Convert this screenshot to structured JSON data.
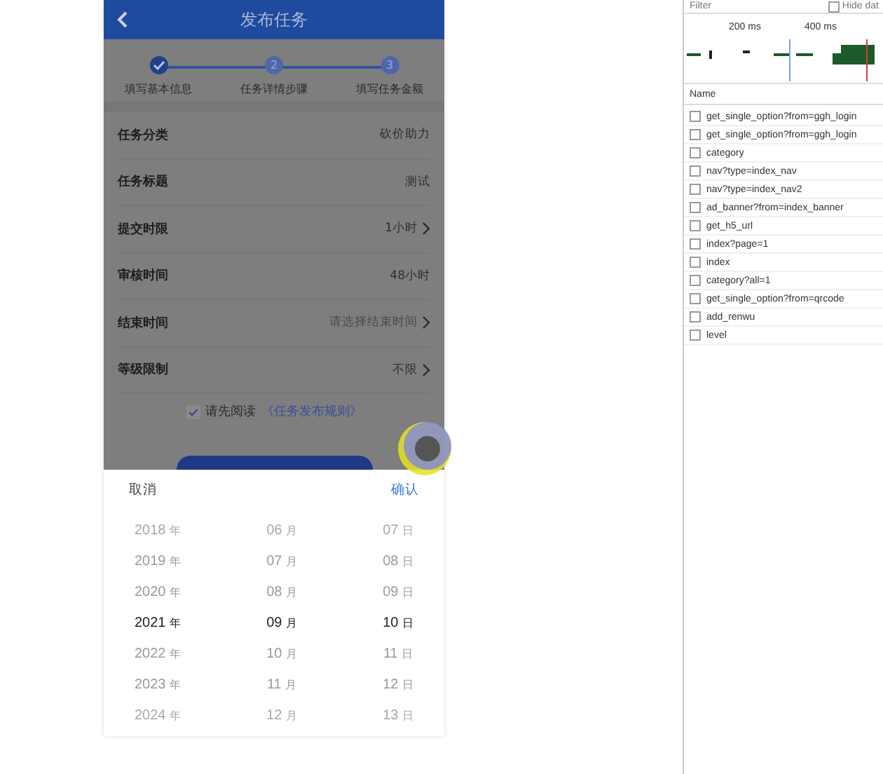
{
  "phone": {
    "title": "发布任务",
    "steps": [
      {
        "label": "填写基本信息",
        "done": true
      },
      {
        "label": "任务详情步骤",
        "number": "2",
        "done": false
      },
      {
        "label": "填写任务金额",
        "number": "3",
        "done": false
      }
    ],
    "fields": [
      {
        "label": "任务分类",
        "value": "砍价助力",
        "arrow": false
      },
      {
        "label": "任务标题",
        "value": "测试",
        "arrow": false
      },
      {
        "label": "提交时限",
        "value": "1小时",
        "arrow": true
      },
      {
        "label": "审核时间",
        "value": "48小时",
        "arrow": false
      },
      {
        "label": "结束时间",
        "placeholder": "请选择结束时间",
        "arrow": true
      },
      {
        "label": "等级限制",
        "value": "不限",
        "arrow": true
      }
    ],
    "agreement": {
      "checked": true,
      "text": "请先阅读",
      "link": "《任务发布规则》"
    },
    "picker": {
      "cancel": "取消",
      "confirm": "确认",
      "columns": [
        {
          "items": [
            {
              "value": "2018",
              "unit": "年",
              "selected": false
            },
            {
              "value": "2019",
              "unit": "年",
              "selected": false
            },
            {
              "value": "2020",
              "unit": "年",
              "selected": false
            },
            {
              "value": "2021",
              "unit": "年",
              "selected": true
            },
            {
              "value": "2022",
              "unit": "年",
              "selected": false
            },
            {
              "value": "2023",
              "unit": "年",
              "selected": false
            },
            {
              "value": "2024",
              "unit": "年",
              "selected": false
            }
          ]
        },
        {
          "items": [
            {
              "value": "06",
              "unit": "月",
              "selected": false
            },
            {
              "value": "07",
              "unit": "月",
              "selected": false
            },
            {
              "value": "08",
              "unit": "月",
              "selected": false
            },
            {
              "value": "09",
              "unit": "月",
              "selected": true
            },
            {
              "value": "10",
              "unit": "月",
              "selected": false
            },
            {
              "value": "11",
              "unit": "月",
              "selected": false
            },
            {
              "value": "12",
              "unit": "月",
              "selected": false
            }
          ]
        },
        {
          "items": [
            {
              "value": "07",
              "unit": "日",
              "selected": false
            },
            {
              "value": "08",
              "unit": "日",
              "selected": false
            },
            {
              "value": "09",
              "unit": "日",
              "selected": false
            },
            {
              "value": "10",
              "unit": "日",
              "selected": true
            },
            {
              "value": "11",
              "unit": "日",
              "selected": false
            },
            {
              "value": "12",
              "unit": "日",
              "selected": false
            },
            {
              "value": "13",
              "unit": "日",
              "selected": false
            }
          ]
        }
      ]
    }
  },
  "devtools": {
    "filter": {
      "placeholder": "Filter"
    },
    "hide_data": {
      "label": "Hide dat",
      "checked": false
    },
    "timeline_ticks": [
      "200 ms",
      "400 ms"
    ],
    "column": "Name",
    "requests": [
      {
        "name": "get_single_option?from=ggh_login",
        "checked": false
      },
      {
        "name": "get_single_option?from=ggh_login",
        "checked": false
      },
      {
        "name": "category",
        "checked": false
      },
      {
        "name": "nav?type=index_nav",
        "checked": false
      },
      {
        "name": "nav?type=index_nav2",
        "checked": false
      },
      {
        "name": "ad_banner?from=index_banner",
        "checked": false
      },
      {
        "name": "get_h5_url",
        "checked": false
      },
      {
        "name": "index?page=1",
        "checked": false
      },
      {
        "name": "index",
        "checked": false
      },
      {
        "name": "category?all=1",
        "checked": false
      },
      {
        "name": "get_single_option?from=qrcode",
        "checked": false
      },
      {
        "name": "add_renwu",
        "checked": false
      },
      {
        "name": "level",
        "checked": false
      }
    ]
  }
}
